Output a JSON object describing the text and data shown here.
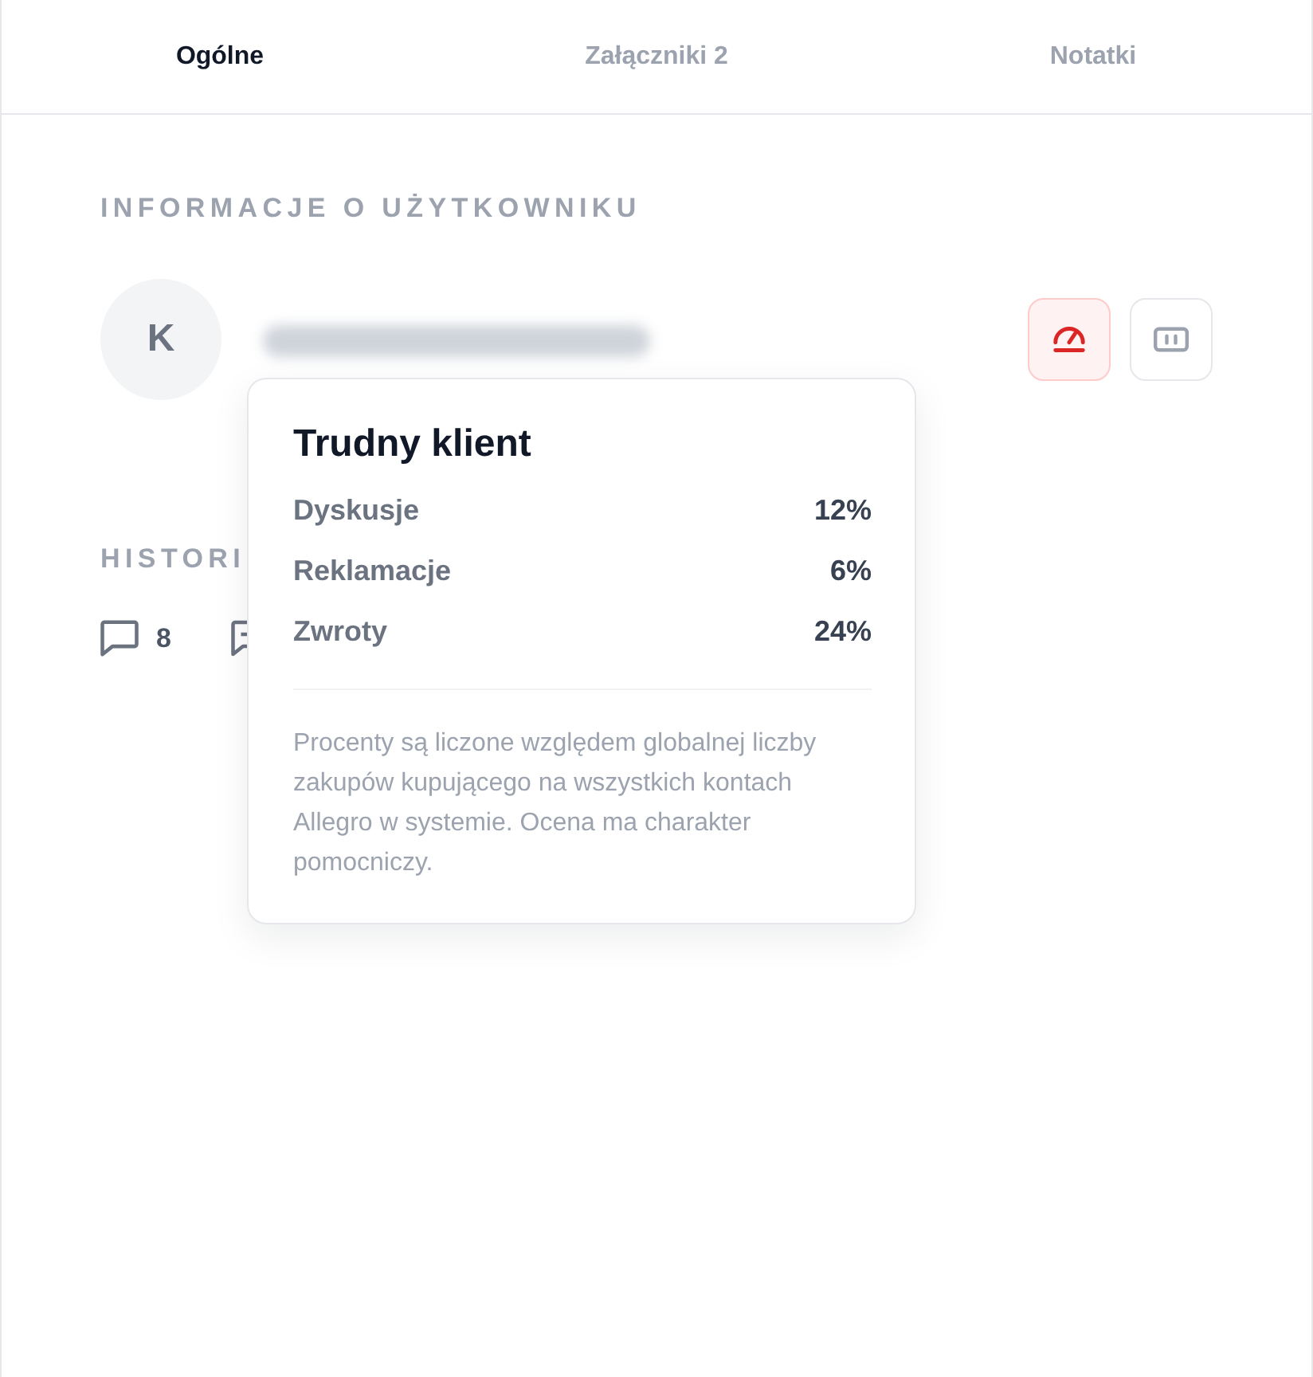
{
  "tabs": [
    {
      "label": "Ogólne",
      "selected": true
    },
    {
      "label": "Załączniki 2",
      "selected": false
    },
    {
      "label": "Notatki",
      "selected": false
    }
  ],
  "user_info": {
    "heading": "INFORMACJE O UŻYTKOWNIKU",
    "avatar_initial": "K",
    "actions": [
      {
        "kind": "gauge",
        "highlighted": true
      },
      {
        "kind": "panel",
        "highlighted": false
      }
    ]
  },
  "history": {
    "heading": "HISTORI",
    "stats": [
      {
        "kind": "chat",
        "count": "8"
      },
      {
        "kind": "note"
      }
    ]
  },
  "popover": {
    "title": "Trudny klient",
    "rows": [
      {
        "label": "Dyskusje",
        "value": "12%"
      },
      {
        "label": "Reklamacje",
        "value": "6%"
      },
      {
        "label": "Zwroty",
        "value": "24%"
      }
    ],
    "note": "Procenty są liczone względem globalnej liczby zakupów kupującego na wszystkich kontach Allegro w systemie. Ocena ma charakter pomocniczy."
  }
}
